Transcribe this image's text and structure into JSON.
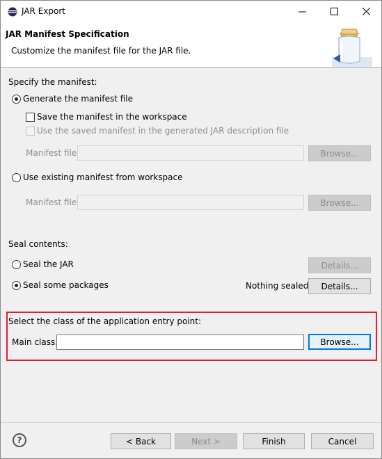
{
  "window": {
    "title": "JAR Export"
  },
  "titlebar_icons": {
    "minimize": "minimize-icon",
    "maximize": "maximize-icon",
    "close": "close-icon"
  },
  "banner": {
    "title": "JAR Manifest Specification",
    "description": "Customize the manifest file for the JAR file."
  },
  "manifest": {
    "section_label": "Specify the manifest:",
    "generate_radio": "Generate the manifest file",
    "save_checkbox": "Save the manifest in the workspace",
    "use_saved_checkbox": "Use the saved manifest in the generated JAR description file",
    "manifest_file_label_1": "Manifest file:",
    "browse_1": "Browse...",
    "use_existing_radio": "Use existing manifest from workspace",
    "manifest_file_label_2": "Manifest file:",
    "browse_2": "Browse..."
  },
  "seal": {
    "section_label": "Seal contents:",
    "seal_jar_radio": "Seal the JAR",
    "details_1": "Details...",
    "seal_some_radio": "Seal some packages",
    "status": "Nothing sealed",
    "details_2": "Details..."
  },
  "entry_point": {
    "section_label": "Select the class of the application entry point:",
    "main_class_label": "Main class:",
    "main_class_value": "",
    "browse": "Browse..."
  },
  "footer": {
    "back": "< Back",
    "next": "Next >",
    "finish": "Finish",
    "cancel": "Cancel",
    "help": "?"
  }
}
